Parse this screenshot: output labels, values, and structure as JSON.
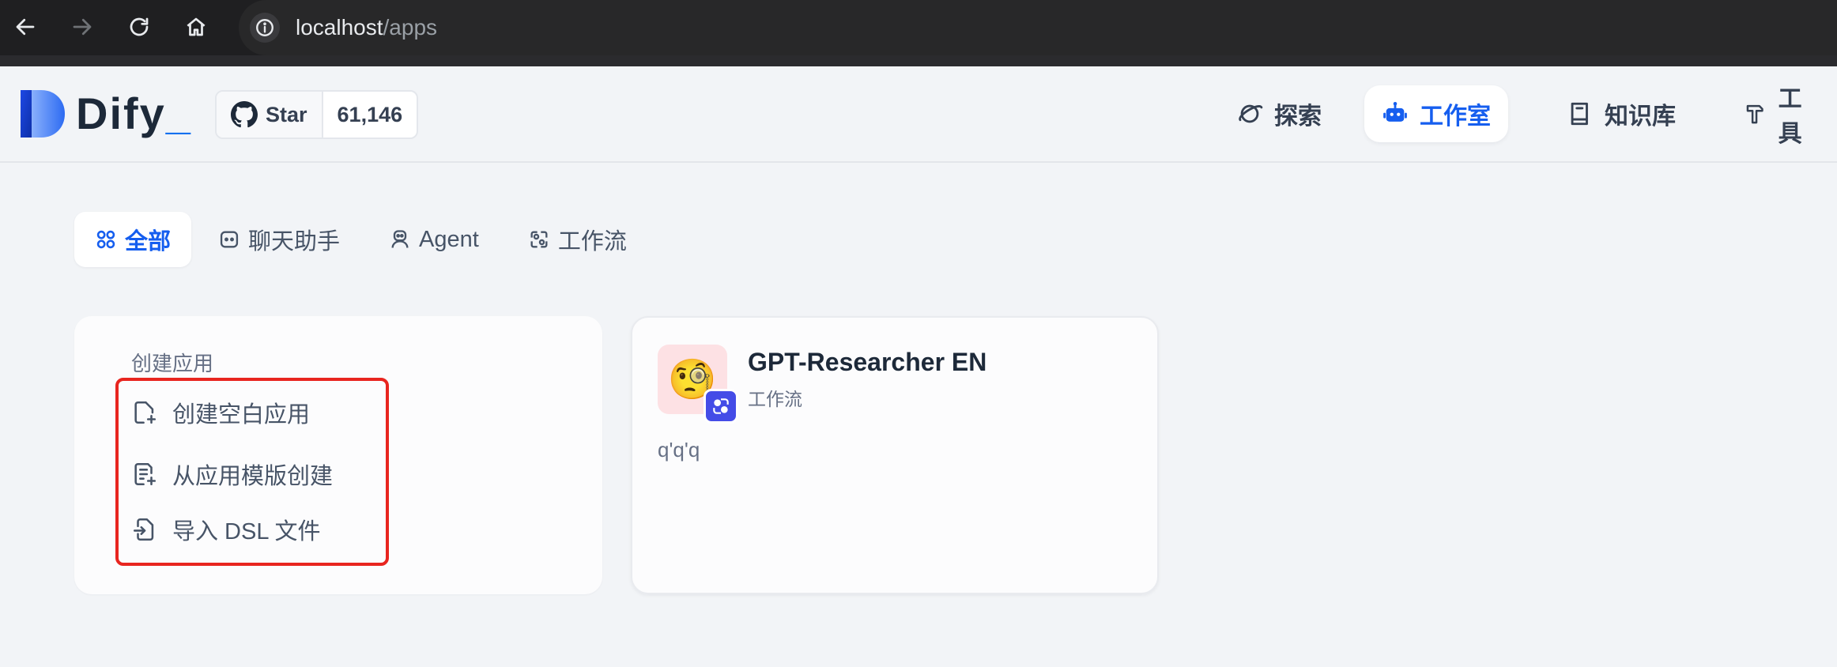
{
  "browser": {
    "url_host": "localhost",
    "url_path": "/apps"
  },
  "header": {
    "logo_text": "Dify",
    "logo_suffix": "_",
    "github": {
      "star_label": "Star",
      "star_count": "61,146"
    },
    "nav": [
      {
        "label": "探索",
        "icon": "planet-icon",
        "active": false
      },
      {
        "label": "工作室",
        "icon": "robot-icon",
        "active": true
      },
      {
        "label": "知识库",
        "icon": "book-icon",
        "active": false
      },
      {
        "label": "工具",
        "icon": "hammer-icon",
        "active": false
      }
    ]
  },
  "filters": {
    "tabs": [
      {
        "label": "全部",
        "icon": "grid-icon",
        "active": true
      },
      {
        "label": "聊天助手",
        "icon": "chat-bot-icon",
        "active": false
      },
      {
        "label": "Agent",
        "icon": "agent-icon",
        "active": false
      },
      {
        "label": "工作流",
        "icon": "workflow-icon",
        "active": false
      }
    ]
  },
  "create_card": {
    "title": "创建应用",
    "items": [
      {
        "label": "创建空白应用",
        "icon": "file-plus-icon"
      },
      {
        "label": "从应用模版创建",
        "icon": "template-icon"
      },
      {
        "label": "导入 DSL 文件",
        "icon": "file-import-icon"
      }
    ]
  },
  "apps": [
    {
      "name": "GPT-Researcher EN",
      "type": "工作流",
      "description": "q'q'q",
      "emoji": "🧐",
      "icon_bg": "#fde1e4",
      "badge_color": "#444ce7"
    }
  ],
  "colors": {
    "accent": "#155eef",
    "highlight": "#e8251f"
  }
}
